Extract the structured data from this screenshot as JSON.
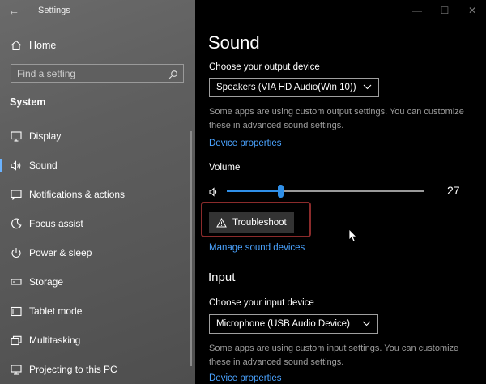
{
  "window": {
    "title": "Settings"
  },
  "sidebar": {
    "home_label": "Home",
    "search_placeholder": "Find a setting",
    "section_title": "System",
    "items": [
      {
        "label": "Display",
        "icon": "monitor-icon"
      },
      {
        "label": "Sound",
        "icon": "speaker-icon",
        "active": true
      },
      {
        "label": "Notifications & actions",
        "icon": "notifications-icon"
      },
      {
        "label": "Focus assist",
        "icon": "moon-icon"
      },
      {
        "label": "Power & sleep",
        "icon": "power-icon"
      },
      {
        "label": "Storage",
        "icon": "storage-icon"
      },
      {
        "label": "Tablet mode",
        "icon": "tablet-icon"
      },
      {
        "label": "Multitasking",
        "icon": "multitasking-icon"
      },
      {
        "label": "Projecting to this PC",
        "icon": "projecting-icon"
      }
    ]
  },
  "main": {
    "title": "Sound",
    "output": {
      "label": "Choose your output device",
      "selected": "Speakers (VIA HD Audio(Win 10))",
      "desc_line1": "Some apps are using custom output settings. You can customize",
      "desc_line2": "these in advanced sound settings.",
      "device_properties": "Device properties"
    },
    "volume": {
      "label": "Volume",
      "value": "27",
      "level_percent": 27
    },
    "troubleshoot_label": "Troubleshoot",
    "manage_devices": "Manage sound devices",
    "input": {
      "heading": "Input",
      "label": "Choose your input device",
      "selected": "Microphone (USB Audio Device)",
      "desc_line1": "Some apps are using custom input settings. You can customize",
      "desc_line2": "these in advanced sound settings.",
      "device_properties": "Device properties"
    }
  },
  "colors": {
    "accent": "#2f8fe8",
    "link": "#4aa3ff",
    "highlight_border": "#8b2b2b"
  }
}
